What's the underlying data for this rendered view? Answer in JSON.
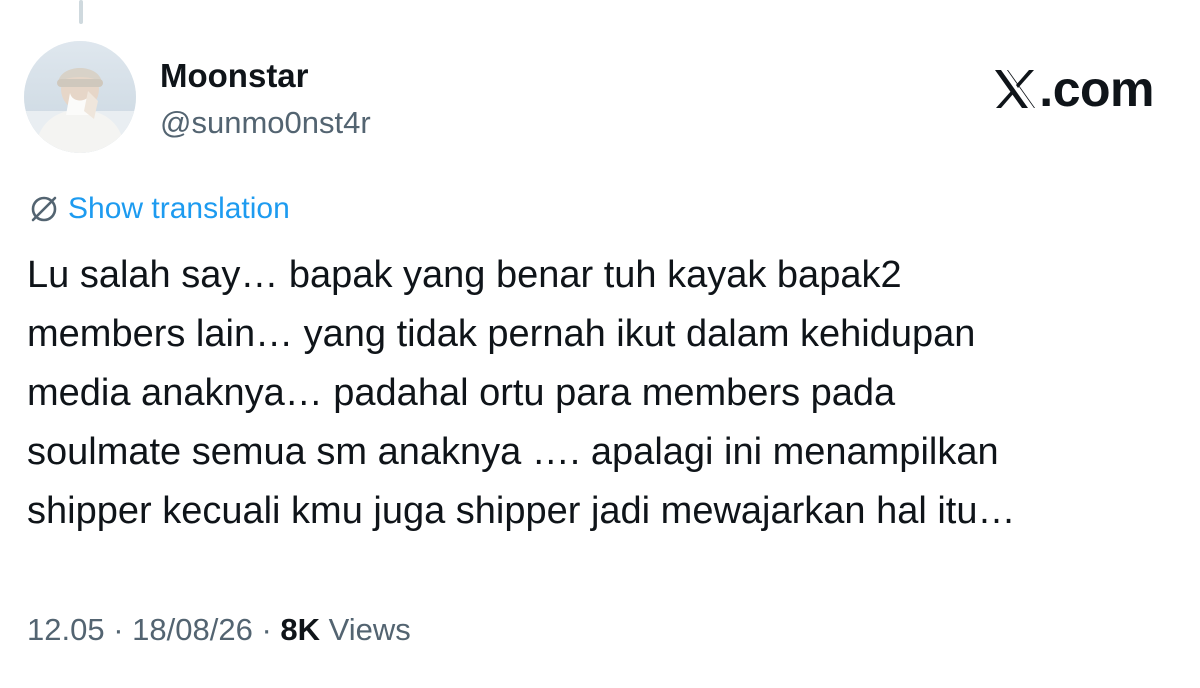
{
  "author": {
    "display_name": "Moonstar",
    "handle": "@sunmo0nst4r"
  },
  "brand": {
    "label": ".com",
    "icon": "x-logo-icon"
  },
  "translation": {
    "label": "Show translation",
    "icon": "translate-globe-icon"
  },
  "tweet": {
    "lines": [
      "Lu salah say… bapak yang benar tuh kayak bapak2",
      "members lain… yang tidak pernah ikut dalam kehidupan",
      "media anaknya… padahal ortu para members pada",
      "soulmate semua sm anaknya …. apalagi ini menampilkan",
      "shipper kecuali kmu juga shipper jadi mewajarkan hal itu…"
    ]
  },
  "meta": {
    "time": "12.05",
    "separator": "·",
    "date": "18/08/26",
    "views_count": "8K",
    "views_label": "Views"
  },
  "colors": {
    "text_primary": "#0f1419",
    "text_secondary": "#536471",
    "accent": "#1d9bf0"
  }
}
